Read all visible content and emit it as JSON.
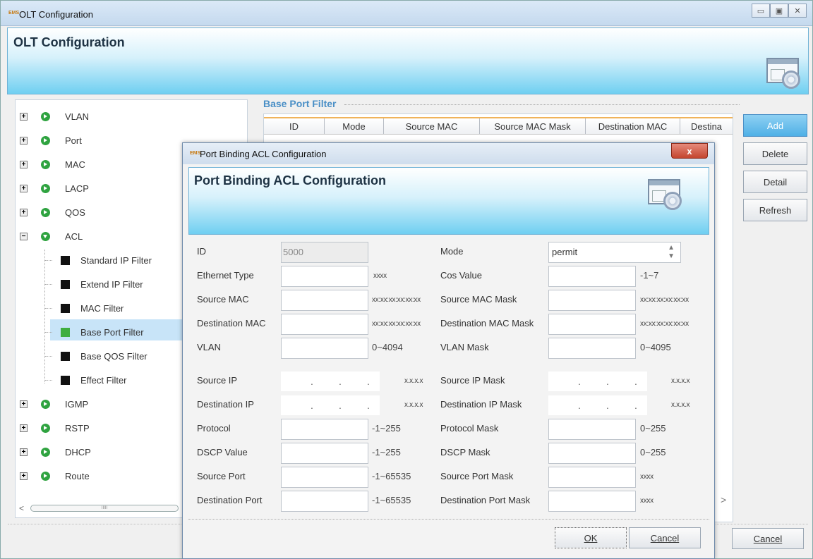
{
  "window": {
    "logo": "EMS",
    "title": "OLT Configuration",
    "banner_title": "OLT Configuration",
    "banner_icon": "config-icon"
  },
  "tree": {
    "items": [
      {
        "label": "VLAN",
        "expand": "+"
      },
      {
        "label": "Port",
        "expand": "+"
      },
      {
        "label": "MAC",
        "expand": "+"
      },
      {
        "label": "LACP",
        "expand": "+"
      },
      {
        "label": "QOS",
        "expand": "+"
      },
      {
        "label": "ACL",
        "expand": "−"
      },
      {
        "label": "IGMP",
        "expand": "+"
      },
      {
        "label": "RSTP",
        "expand": "+"
      },
      {
        "label": "DHCP",
        "expand": "+"
      },
      {
        "label": "Route",
        "expand": "+"
      }
    ],
    "acl_children": [
      "Standard IP Filter",
      "Extend IP Filter",
      "MAC Filter",
      "Base Port Filter",
      "Base QOS Filter",
      "Effect Filter"
    ],
    "selected": "Base Port Filter",
    "scroll_thumb": "IIIII",
    "scroll_arrow": "<"
  },
  "panel": {
    "title": "Base Port Filter",
    "columns": [
      "ID",
      "Mode",
      "Source MAC",
      "Source MAC Mask",
      "Destination MAC",
      "Destina"
    ]
  },
  "buttons": {
    "add": "Add",
    "delete": "Delete",
    "detail": "Detail",
    "refresh": "Refresh",
    "cancel": "Cancel",
    "scroll_right": ">"
  },
  "dialog": {
    "logo": "EMS",
    "title": "Port Binding ACL Configuration",
    "banner_title": "Port Binding ACL Configuration",
    "close": "x",
    "fields": {
      "id_label": "ID",
      "id_value": "5000",
      "mode_label": "Mode",
      "mode_value": "permit",
      "ethtype_label": "Ethernet Type",
      "ethtype_hint": "xxxx",
      "cos_label": "Cos Value",
      "cos_hint": "-1~7",
      "smac_label": "Source MAC",
      "smac_hint": "xx:xx:xx:xx:xx:xx",
      "smacmask_label": "Source MAC Mask",
      "smacmask_hint": "xx:xx:xx:xx:xx:xx",
      "dmac_label": "Destination MAC",
      "dmac_hint": "xx:xx:xx:xx:xx:xx",
      "dmacmask_label": "Destination MAC Mask",
      "dmacmask_hint": "xx:xx:xx:xx:xx:xx",
      "vlan_label": "VLAN",
      "vlan_hint": "0~4094",
      "vlanmask_label": "VLAN Mask",
      "vlanmask_hint": "0~4095",
      "sip_label": "Source IP",
      "sip_hint": "x.x.x.x",
      "sipmask_label": "Source IP Mask",
      "sipmask_hint": "x.x.x.x",
      "dip_label": "Destination IP",
      "dip_hint": "x.x.x.x",
      "dipmask_label": "Destination IP Mask",
      "dipmask_hint": "x.x.x.x",
      "proto_label": "Protocol",
      "proto_hint": "-1~255",
      "protomask_label": "Protocol Mask",
      "protomask_hint": "0~255",
      "dscp_label": "DSCP Value",
      "dscp_hint": "-1~255",
      "dscpmask_label": "DSCP Mask",
      "dscpmask_hint": "0~255",
      "sport_label": "Source Port",
      "sport_hint": "-1~65535",
      "sportmask_label": "Source Port Mask",
      "sportmask_hint": "xxxx",
      "dport_label": "Destination Port",
      "dport_hint": "-1~65535",
      "dportmask_label": "Destination Port Mask",
      "dportmask_hint": "xxxx"
    },
    "ip_dot": ".",
    "mode_spin": "▲▼",
    "ok": "OK",
    "cancel": "Cancel"
  },
  "colors": {
    "accent": "#4fb0e6",
    "banner": "#6fcff1",
    "tree_selected": "#c8e4f8",
    "tree_node": "#2fa340"
  }
}
